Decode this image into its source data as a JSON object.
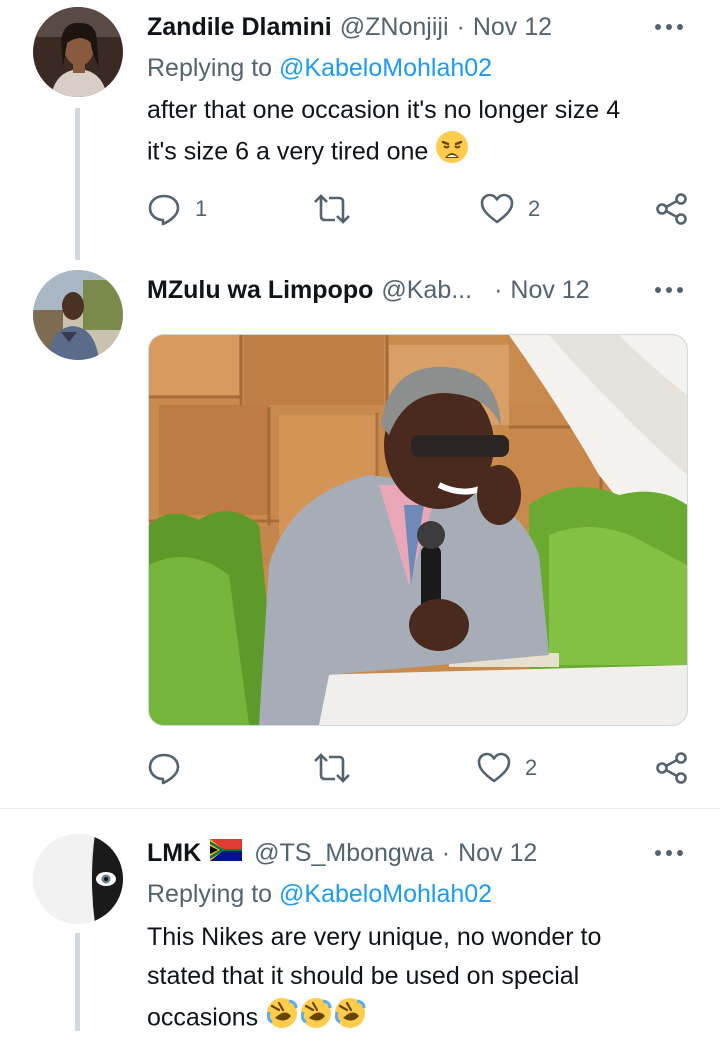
{
  "tweets": [
    {
      "name": "Zandile Dlamini",
      "handle": "@ZNonjiji",
      "dot": "·",
      "date": "Nov 12",
      "replying_prefix": "Replying to",
      "replying_to": "@KabeloMohlah02",
      "text_line1": "after that one occasion it's no longer size 4",
      "text_line2": "it's size 6 a very tired one",
      "emoji": "weary-face-emoji",
      "reply_count": "1",
      "retweet_count": "",
      "like_count": "2"
    },
    {
      "name": "MZulu wa Limpopo",
      "handle": "@Kab...",
      "dot": "·",
      "date": "Nov 12",
      "reply_count": "",
      "retweet_count": "",
      "like_count": "2",
      "media": "photo of a smiling man in a grey suit holding a microphone at a podium"
    },
    {
      "name": "LMK",
      "flag": "south-africa-flag-emoji",
      "handle": "@TS_Mbongwa",
      "dot": "·",
      "date": "Nov 12",
      "replying_prefix": "Replying to",
      "replying_to": "@KabeloMohlah02",
      "text_line1": "This Nikes are very unique, no wonder to",
      "text_line2": "stated that it should be used on special",
      "text_line3": "occasions",
      "emoji": "rolling-on-floor-laughing-emoji"
    }
  ],
  "icons": {
    "reply": "reply-icon",
    "retweet": "retweet-icon",
    "like": "heart-icon",
    "share": "share-icon",
    "more": "more-icon"
  },
  "colors": {
    "link": "#1d9bf0",
    "secondary_text": "#536471",
    "thread_line": "#cfd9de"
  }
}
